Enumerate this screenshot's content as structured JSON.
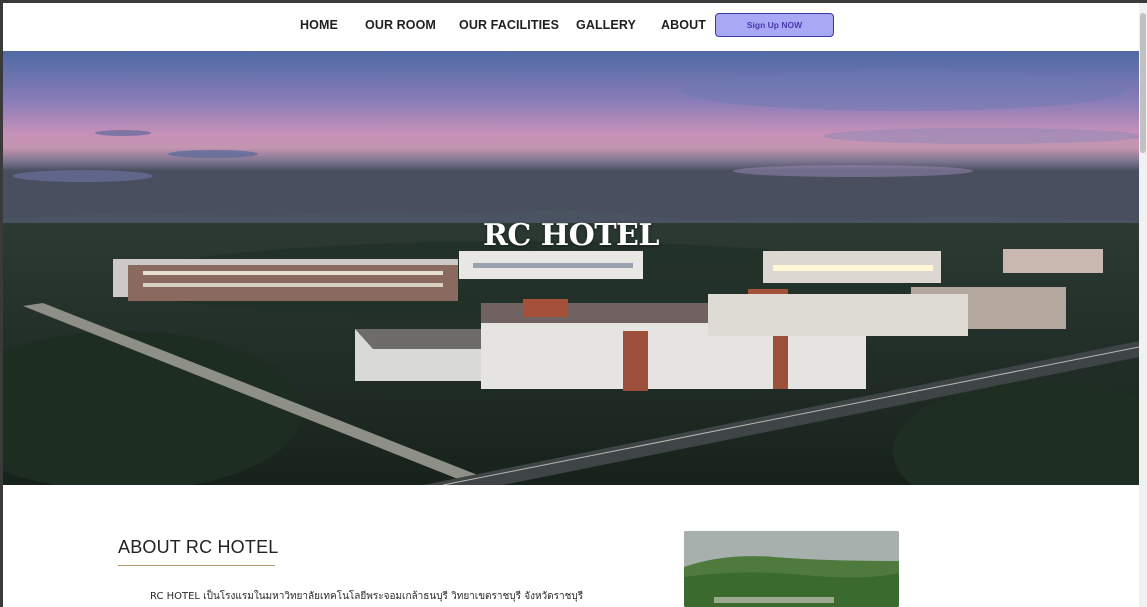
{
  "nav": {
    "items": [
      {
        "label": "HOME"
      },
      {
        "label": "OUR ROOM"
      },
      {
        "label": "OUR FACILITIES"
      },
      {
        "label": "GALLERY"
      },
      {
        "label": "ABOUT"
      }
    ],
    "signup_label": "Sign Up NOW"
  },
  "hero": {
    "title": "RC HOTEL",
    "image": "aerial campus photo at dusk"
  },
  "about": {
    "heading": "ABOUT RC HOTEL",
    "text": "RC HOTEL เป็นโรงแรมในมหาวิทยาลัยเทคโนโลยีพระจอมเกล้าธนบุรี วิทยาเขตราชบุรี จังหวัดราชบุรี",
    "image": "green hillside photo"
  },
  "colors": {
    "signup_bg": "#a9a8f4",
    "signup_border": "#3d3a9c",
    "underline": "#b09868"
  }
}
